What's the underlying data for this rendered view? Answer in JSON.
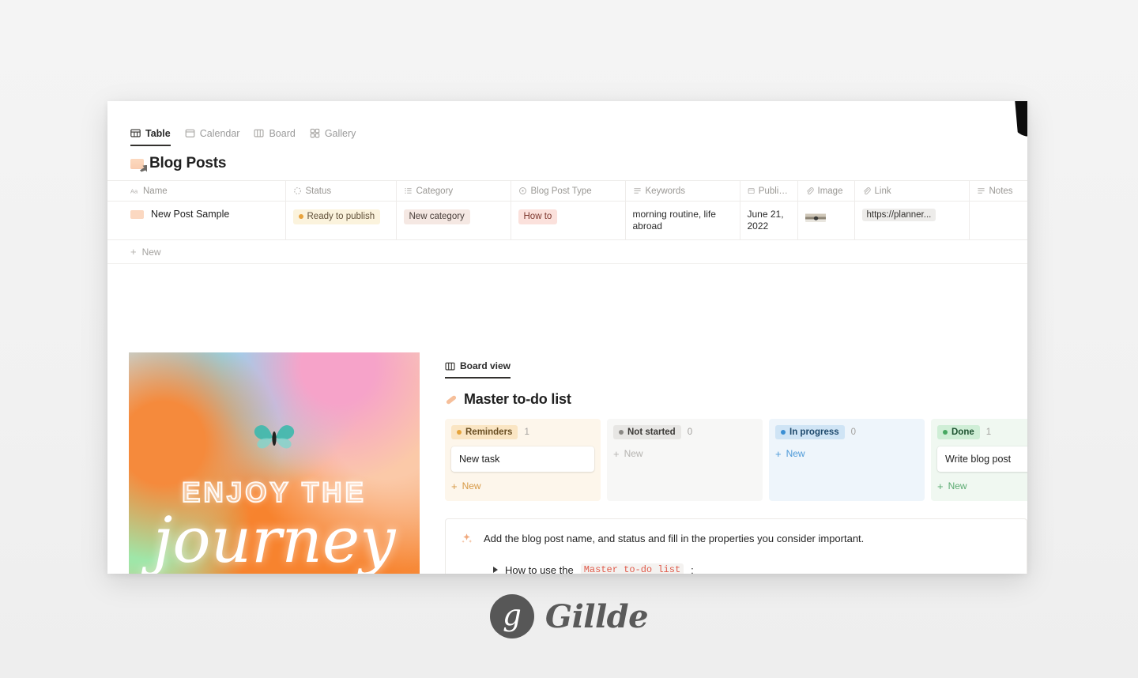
{
  "brand": {
    "mark_letter": "g",
    "name": "Gillde"
  },
  "database": {
    "view_tabs": [
      {
        "label": "Table",
        "icon": "table-icon",
        "active": true
      },
      {
        "label": "Calendar",
        "icon": "calendar-icon",
        "active": false
      },
      {
        "label": "Board",
        "icon": "board-icon",
        "active": false
      },
      {
        "label": "Gallery",
        "icon": "gallery-icon",
        "active": false
      }
    ],
    "title": "Blog Posts",
    "columns": [
      {
        "label": "Name",
        "icon": "text-aa-icon"
      },
      {
        "label": "Status",
        "icon": "status-spinner-icon"
      },
      {
        "label": "Category",
        "icon": "multiselect-icon"
      },
      {
        "label": "Blog Post Type",
        "icon": "select-circle-icon"
      },
      {
        "label": "Keywords",
        "icon": "text-lines-icon"
      },
      {
        "label": "Publica...",
        "icon": "date-icon"
      },
      {
        "label": "Image",
        "icon": "attachment-icon"
      },
      {
        "label": "Link",
        "icon": "attachment-icon"
      },
      {
        "label": "Notes",
        "icon": "text-lines-icon"
      }
    ],
    "rows": [
      {
        "name": "New Post Sample",
        "status": "Ready to publish",
        "category": "New category",
        "type": "How to",
        "keywords": "morning routine, life abroad",
        "publication_date": "June 21, 2022",
        "image": "beach-thumbnail",
        "link": "https://planner...",
        "notes": ""
      }
    ],
    "new_row_label": "New"
  },
  "poster": {
    "line1": "ENJOY THE",
    "line2": "journey",
    "icon": "butterfly-icon"
  },
  "board": {
    "tab_label": "Board view",
    "tab_icon": "board-icon",
    "title": "Master to-do list",
    "title_icon": "bandage-icon",
    "new_label": "New",
    "columns": [
      {
        "label": "Reminders",
        "count": "1",
        "accent": "#e6a43c",
        "cards": [
          {
            "title": "New task"
          }
        ]
      },
      {
        "label": "Not started",
        "count": "0",
        "accent": "#8a8884",
        "cards": []
      },
      {
        "label": "In progress",
        "count": "0",
        "accent": "#3b8fd4",
        "cards": []
      },
      {
        "label": "Done",
        "count": "1",
        "accent": "#46a861",
        "cards": [
          {
            "title": "Write blog post"
          }
        ]
      }
    ]
  },
  "callout": {
    "icon": "sparkle-icon",
    "text": "Add the blog post name, and status and fill in the properties you consider important.",
    "toggle_prefix": "How to use the",
    "toggle_code": "Master to-do list",
    "toggle_suffix": ":"
  }
}
